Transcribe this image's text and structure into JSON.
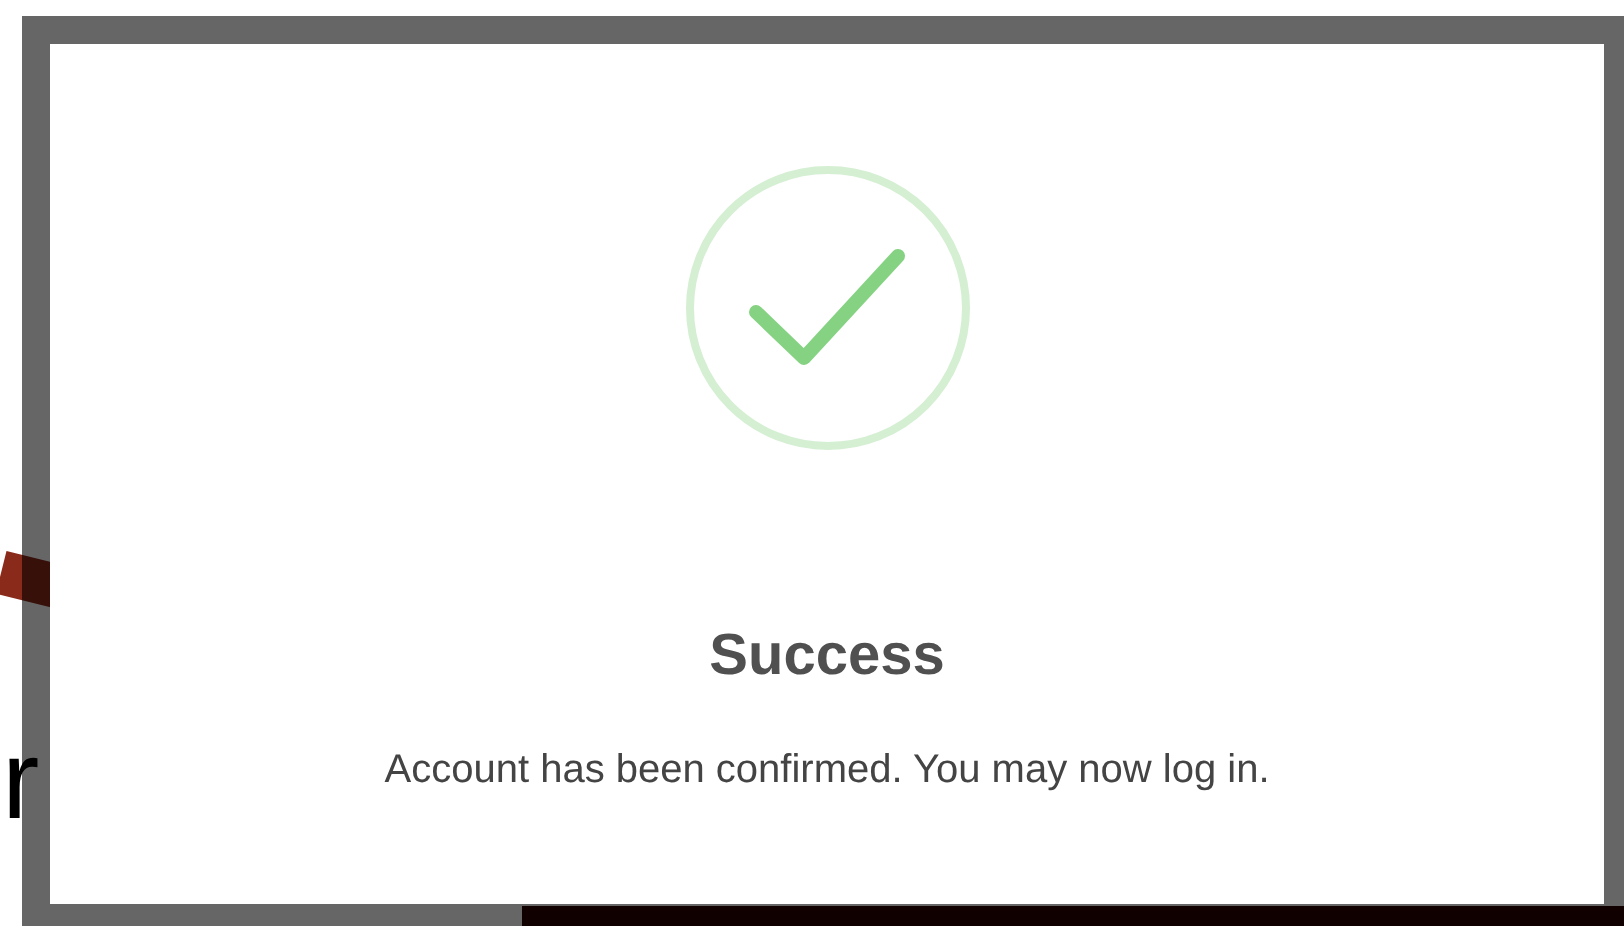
{
  "background": {
    "text_fragment": "r"
  },
  "dialog": {
    "title": "Success",
    "message": "Account has been confirmed. You may now log in."
  }
}
